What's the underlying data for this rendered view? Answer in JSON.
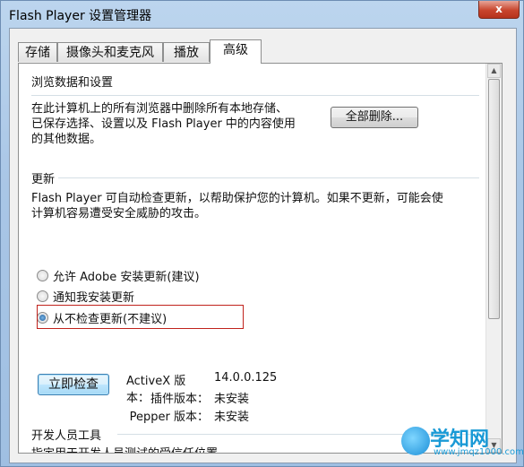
{
  "window": {
    "title": "Flash Player 设置管理器",
    "close_label": "x"
  },
  "tabs": [
    {
      "label": "存储"
    },
    {
      "label": "摄像头和麦克风"
    },
    {
      "label": "播放"
    },
    {
      "label": "高级"
    }
  ],
  "browse_section": {
    "title": "浏览数据和设置",
    "text_line1": "在此计算机上的所有浏览器中删除所有本地存储、",
    "text_line2": "已保存选择、设置以及 Flash Player 中的内容使用",
    "text_line3": "的其他数据。",
    "delete_all_button": "全部删除..."
  },
  "update_section": {
    "title": "更新",
    "text_line1": "Flash Player 可自动检查更新，以帮助保护您的计算机。如果不更新，可能会使",
    "text_line2": "计算机容易遭受安全威胁的攻击。",
    "options": [
      {
        "label": "允许 Adobe 安装更新(建议)",
        "checked": false
      },
      {
        "label": "通知我安装更新",
        "checked": false
      },
      {
        "label": "从不检查更新(不建议)",
        "checked": true
      }
    ],
    "check_now_button": "立即检查"
  },
  "versions": [
    {
      "label": "ActiveX 版本：",
      "value": "14.0.0.125"
    },
    {
      "label": "插件版本：",
      "value": "未安装"
    },
    {
      "label": "Pepper 版本：",
      "value": "未安装"
    }
  ],
  "developer_section": {
    "title": "开发人员工具",
    "text": "指定用于开发人员测试的受信任位置。"
  },
  "watermark": {
    "text": "学知网",
    "url": "www.jmqz1000.com"
  }
}
